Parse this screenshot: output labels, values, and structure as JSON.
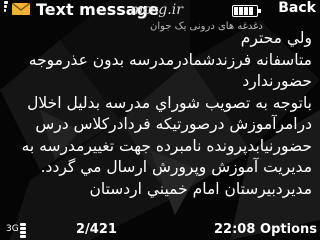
{
  "header": {
    "title": "Text message",
    "watermark_site": "mcsg.ir",
    "watermark_tagline": "دغدغه های درونی یک جوان",
    "back_label": "Back"
  },
  "message": {
    "lines": [
      "ولي محترم",
      "متاسفانه فرزندشمادرمدرسه بدون عذرموجه",
      "حضورندارد",
      "باتوجه به تصويب شوراي مدرسه بدليل اخلال",
      "درامرآموزش درصورتيكه فردادركلاس درس",
      "حضورنيابدپرونده نامبرده جهت تغييرمدرسه به",
      "مديريت آموزش وپرورش ارسال مي گردد.",
      "مديردبيرستان امام خميني اردستان"
    ]
  },
  "status": {
    "network_type": "3G",
    "message_counter": "2/421",
    "time": "22:08",
    "options_label": "Options"
  },
  "icons": {
    "envelope": "envelope-icon",
    "signal": "signal-strength-icon",
    "battery": "battery-icon",
    "network": "network-signal-icon"
  },
  "colors": {
    "background": "#000000",
    "text": "#ffffff",
    "envelope": "#f2b233"
  }
}
